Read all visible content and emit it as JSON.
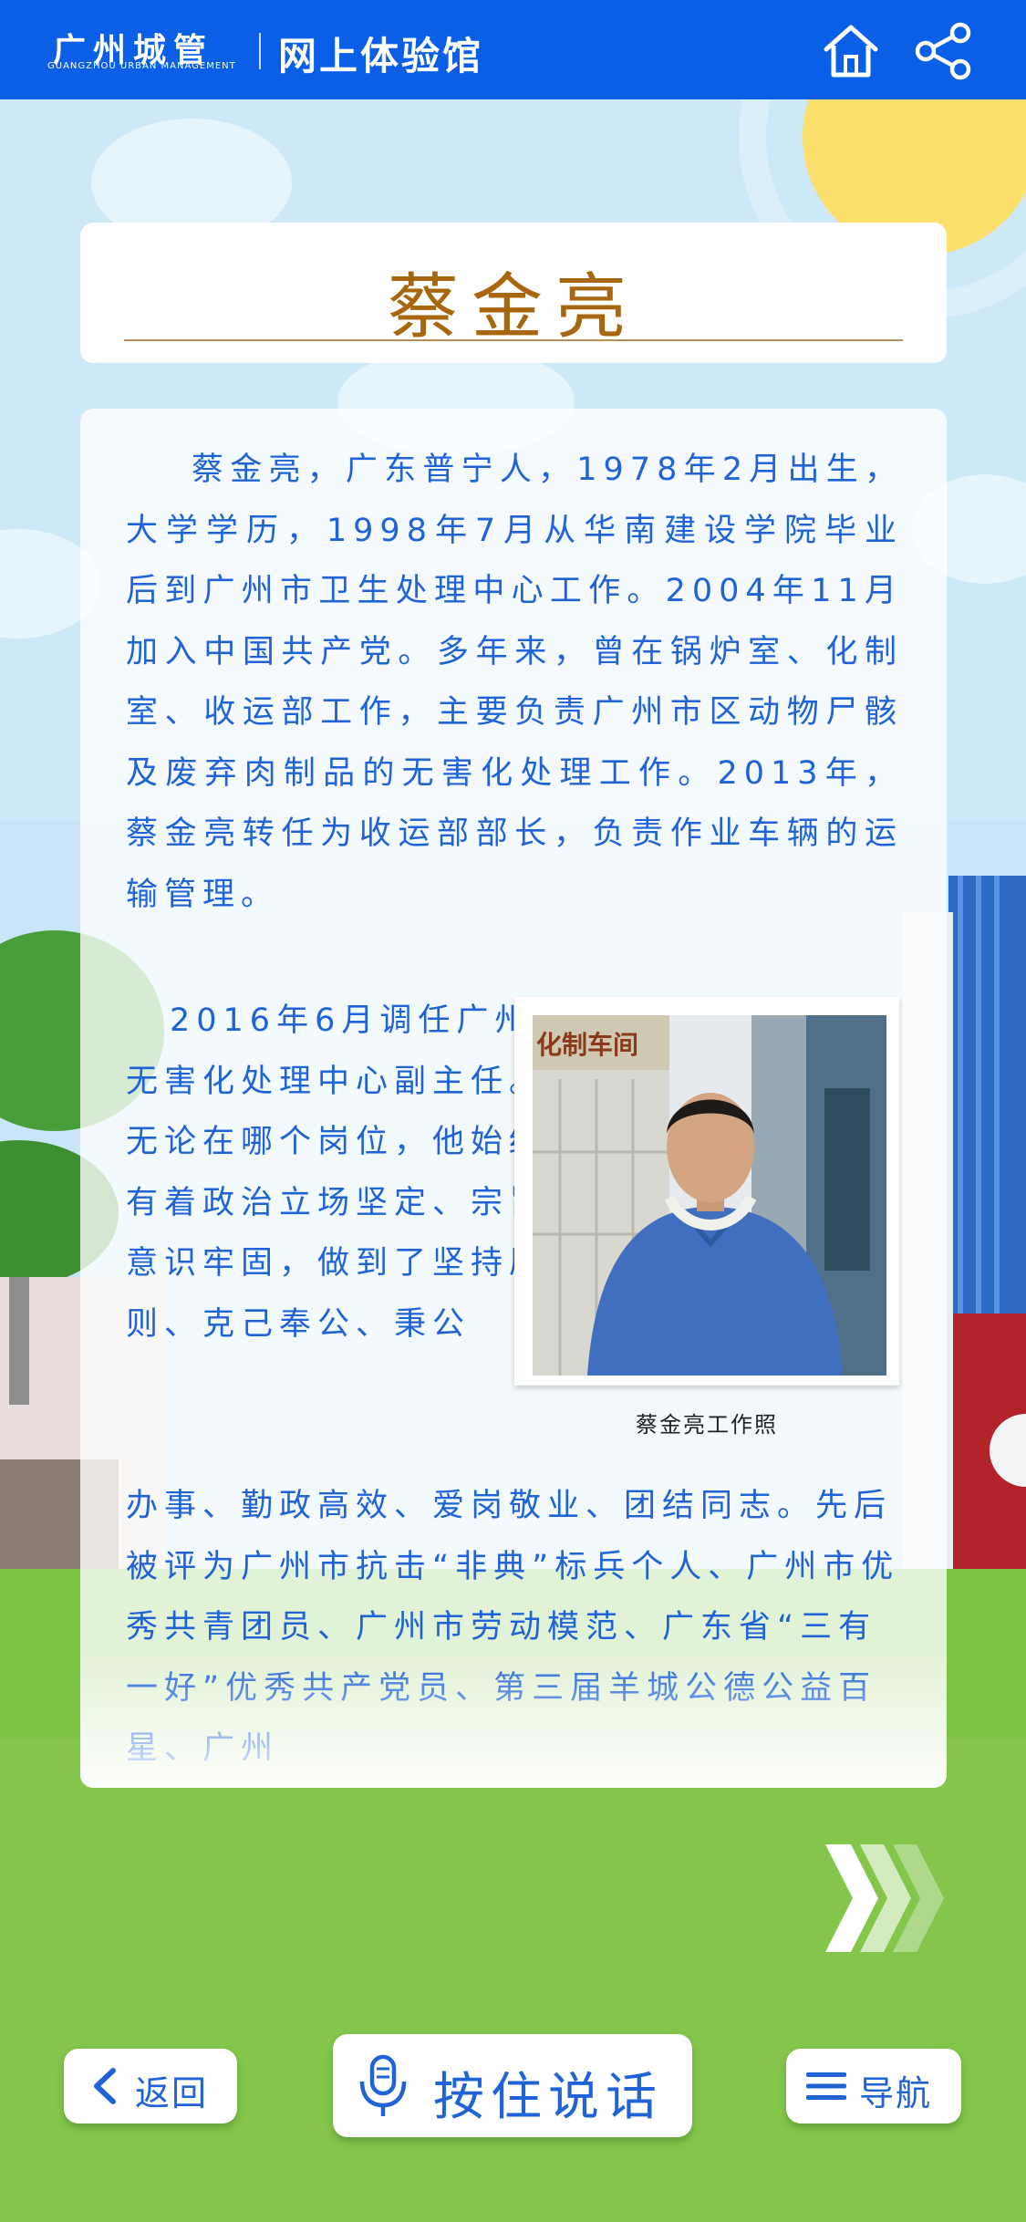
{
  "header": {
    "logo_cn": "广州城管",
    "logo_en": "GUANGZHOU URBAN MANAGEMENT",
    "title": "网上体验馆",
    "home_icon": "home-icon",
    "share_icon": "share-icon"
  },
  "article": {
    "title": "蔡金亮",
    "paragraph1": "蔡金亮，广东普宁人，1978年2月出生，大学学历，1998年7月从华南建设学院毕业后到广州市卫生处理中心工作。2004年11月加入中国共产党。多年来，曾在锅炉室、化制室、收运部工作，主要负责广州市区动物尸骸及废弃肉制品的无害化处理工作。2013年，蔡金亮转任为收运部部长，负责作业车辆的运输管理。",
    "paragraph2_part1": "2016年6月调任广州市无害化处理中心副主任。无论在哪个岗位，他始终有着政治立场坚定、宗旨意识牢固，做到了坚持原则、克己奉公、秉公",
    "paragraph2_part2": "办事、勤政高效、爱岗敬业、团结同志。先后被评为广州市抗击“非典”标兵个人、广州市优秀共青团员、广州市劳动模范、广东省“三有一好”优秀共产党员、第三届羊城公德公益百星、广州",
    "photo_sign": "化制车间",
    "photo_caption": "蔡金亮工作照"
  },
  "controls": {
    "next_icon": "chevron-right-icon",
    "back_label": "返回",
    "talk_label": "按住说话",
    "nav_label": "导航",
    "microphone_icon": "microphone-icon",
    "menu_icon": "menu-icon"
  },
  "colors": {
    "header_blue": "#0a5fe6",
    "text_blue": "#1f63d6",
    "title_brown": "#a8670f",
    "grass_green": "#7cc244"
  }
}
